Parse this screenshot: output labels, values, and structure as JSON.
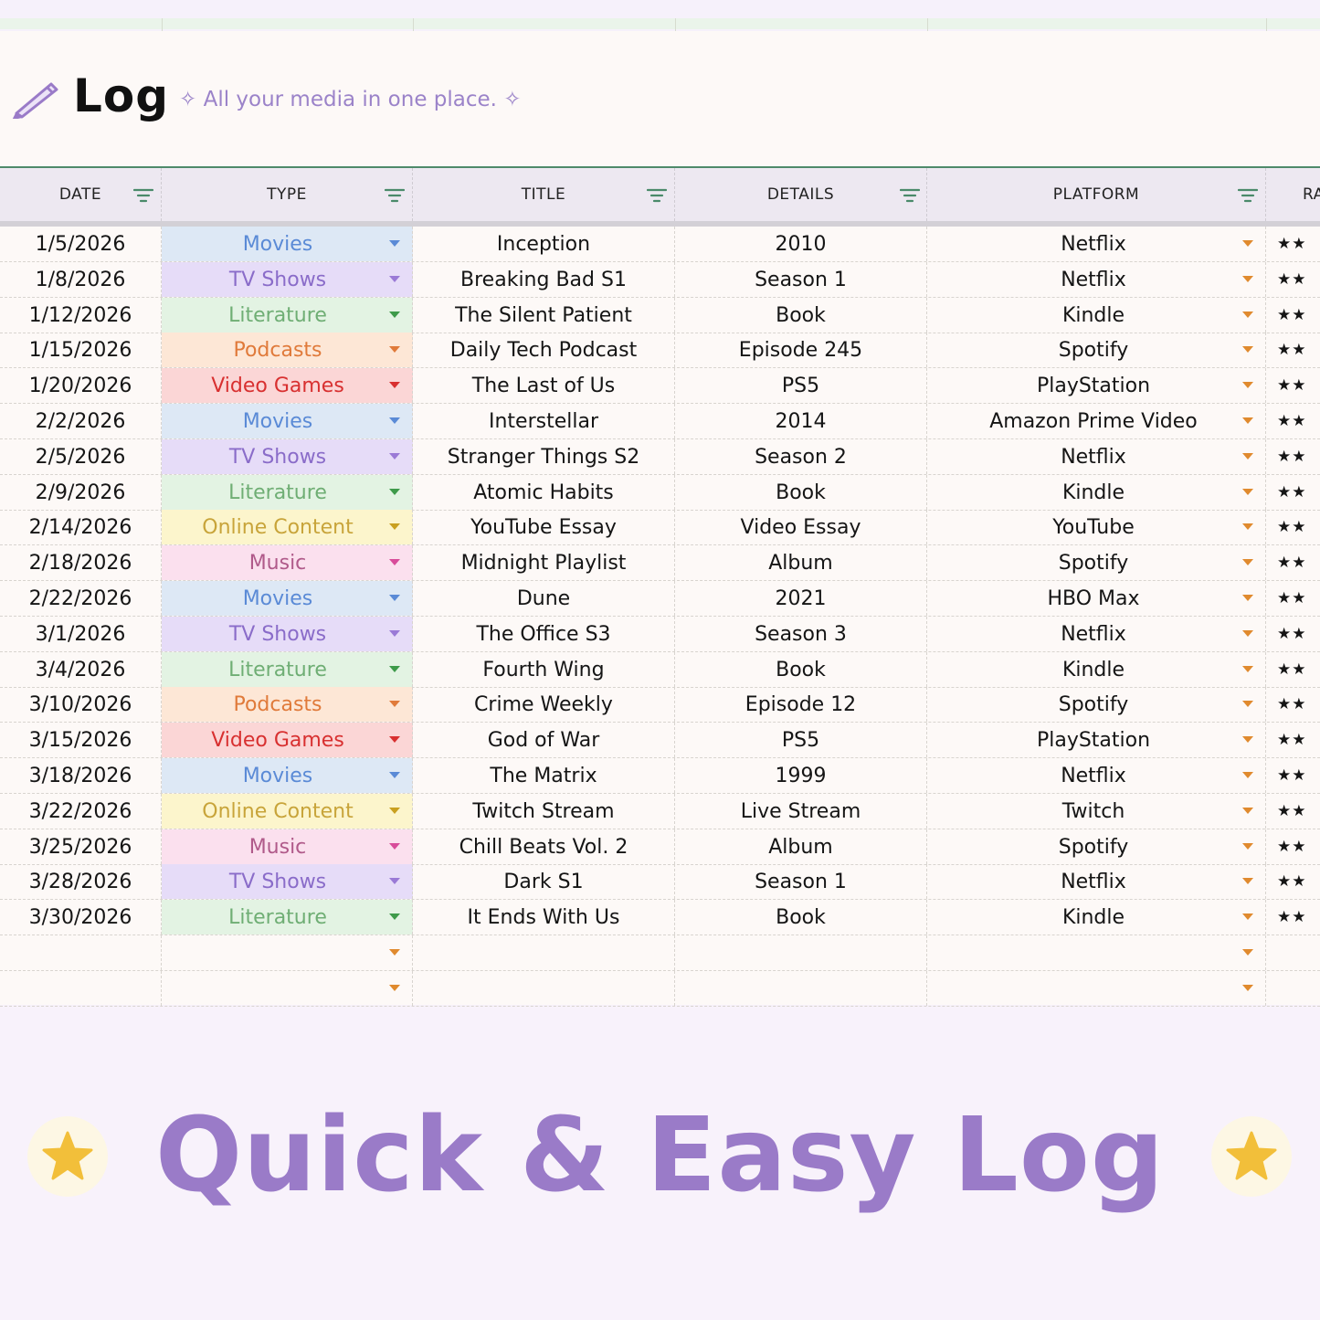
{
  "sheet": {
    "title": "Log",
    "subtitle": "✧ All your media in one place. ✧"
  },
  "columns": [
    "DATE",
    "TYPE",
    "TITLE",
    "DETAILS",
    "PLATFORM",
    "RA"
  ],
  "type_styles": {
    "Movies": {
      "bg": "#dde8f5",
      "fg": "#5a8ad6",
      "caret": "#5a8ad6"
    },
    "TV Shows": {
      "bg": "#e6dcf8",
      "fg": "#8a6cc9",
      "caret": "#9a7ad6"
    },
    "Literature": {
      "bg": "#e3f3e3",
      "fg": "#6fae74",
      "caret": "#3e9a4a"
    },
    "Podcasts": {
      "bg": "#fde7d6",
      "fg": "#e07a3a",
      "caret": "#e07a3a"
    },
    "Video Games": {
      "bg": "#fbd6d6",
      "fg": "#d83030",
      "caret": "#d83030"
    },
    "Online Content": {
      "bg": "#fcf5cc",
      "fg": "#c8a43a",
      "caret": "#c9a020"
    },
    "Music": {
      "bg": "#fbe0ee",
      "fg": "#b05a8a",
      "caret": "#d84c9a"
    }
  },
  "rows": [
    {
      "date": "1/5/2026",
      "type": "Movies",
      "title": "Inception",
      "details": "2010",
      "platform": "Netflix",
      "rating": "★★"
    },
    {
      "date": "1/8/2026",
      "type": "TV Shows",
      "title": "Breaking Bad S1",
      "details": "Season 1",
      "platform": "Netflix",
      "rating": "★★"
    },
    {
      "date": "1/12/2026",
      "type": "Literature",
      "title": "The Silent Patient",
      "details": "Book",
      "platform": "Kindle",
      "rating": "★★"
    },
    {
      "date": "1/15/2026",
      "type": "Podcasts",
      "title": "Daily Tech Podcast",
      "details": "Episode 245",
      "platform": "Spotify",
      "rating": "★★"
    },
    {
      "date": "1/20/2026",
      "type": "Video Games",
      "title": "The Last of Us",
      "details": "PS5",
      "platform": "PlayStation",
      "rating": "★★"
    },
    {
      "date": "2/2/2026",
      "type": "Movies",
      "title": "Interstellar",
      "details": "2014",
      "platform": "Amazon Prime Video",
      "rating": "★★"
    },
    {
      "date": "2/5/2026",
      "type": "TV Shows",
      "title": "Stranger Things S2",
      "details": "Season 2",
      "platform": "Netflix",
      "rating": "★★"
    },
    {
      "date": "2/9/2026",
      "type": "Literature",
      "title": "Atomic Habits",
      "details": "Book",
      "platform": "Kindle",
      "rating": "★★"
    },
    {
      "date": "2/14/2026",
      "type": "Online Content",
      "title": "YouTube Essay",
      "details": "Video Essay",
      "platform": "YouTube",
      "rating": "★★"
    },
    {
      "date": "2/18/2026",
      "type": "Music",
      "title": "Midnight Playlist",
      "details": "Album",
      "platform": "Spotify",
      "rating": "★★"
    },
    {
      "date": "2/22/2026",
      "type": "Movies",
      "title": "Dune",
      "details": "2021",
      "platform": "HBO Max",
      "rating": "★★"
    },
    {
      "date": "3/1/2026",
      "type": "TV Shows",
      "title": "The Office S3",
      "details": "Season 3",
      "platform": "Netflix",
      "rating": "★★"
    },
    {
      "date": "3/4/2026",
      "type": "Literature",
      "title": "Fourth Wing",
      "details": "Book",
      "platform": "Kindle",
      "rating": "★★"
    },
    {
      "date": "3/10/2026",
      "type": "Podcasts",
      "title": "Crime Weekly",
      "details": "Episode 12",
      "platform": "Spotify",
      "rating": "★★"
    },
    {
      "date": "3/15/2026",
      "type": "Video Games",
      "title": "God of War",
      "details": "PS5",
      "platform": "PlayStation",
      "rating": "★★"
    },
    {
      "date": "3/18/2026",
      "type": "Movies",
      "title": "The Matrix",
      "details": "1999",
      "platform": "Netflix",
      "rating": "★★"
    },
    {
      "date": "3/22/2026",
      "type": "Online Content",
      "title": "Twitch Stream",
      "details": "Live Stream",
      "platform": "Twitch",
      "rating": "★★"
    },
    {
      "date": "3/25/2026",
      "type": "Music",
      "title": "Chill Beats Vol. 2",
      "details": "Album",
      "platform": "Spotify",
      "rating": "★★"
    },
    {
      "date": "3/28/2026",
      "type": "TV Shows",
      "title": "Dark S1",
      "details": "Season 1",
      "platform": "Netflix",
      "rating": "★★"
    },
    {
      "date": "3/30/2026",
      "type": "Literature",
      "title": "It Ends With Us",
      "details": "Book",
      "platform": "Kindle",
      "rating": "★★"
    },
    {
      "date": "",
      "type": "",
      "title": "",
      "details": "",
      "platform": "",
      "rating": ""
    },
    {
      "date": "",
      "type": "",
      "title": "",
      "details": "",
      "platform": "",
      "rating": ""
    }
  ],
  "banner": {
    "title": "Quick & Easy Log",
    "star_color": "#f2bf3a",
    "badge_color": "#fdf7e4"
  },
  "accent_color": "#9a7bc8",
  "caret_color": "#e08a2e"
}
